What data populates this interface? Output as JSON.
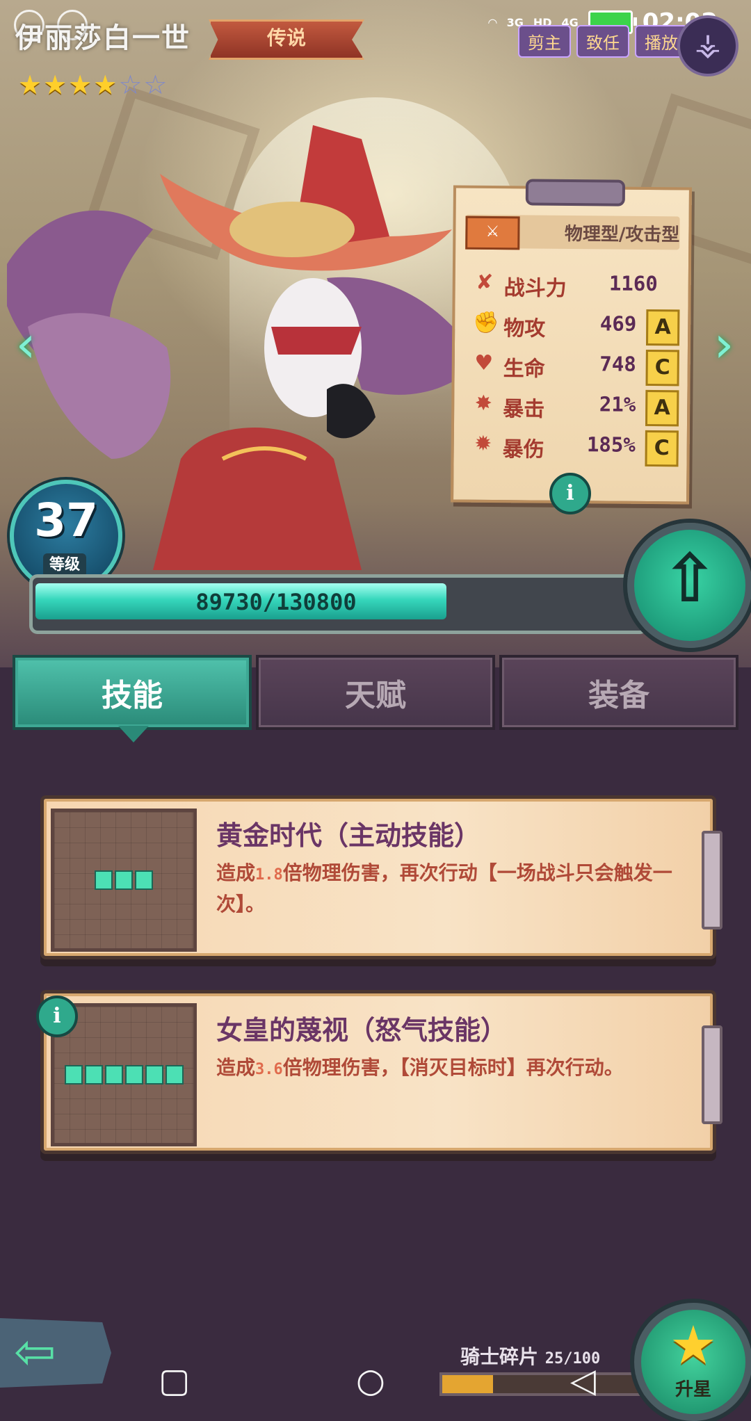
{
  "status_bar": {
    "signal_a": "3G",
    "signal_b": "4G",
    "hd": "HD",
    "time": "02:02"
  },
  "hero": {
    "name": "伊丽莎白一世",
    "rarity": "传说",
    "stars_total": 6,
    "stars_filled": 4,
    "top_buttons": [
      "剪主",
      "致任",
      "播放"
    ],
    "skin_icon": "fish-skeleton-icon"
  },
  "stat_card": {
    "type_label": "物理型/攻击型",
    "weapon_icon": "sword-icon",
    "stats": [
      {
        "icon": "power-icon",
        "glyph": "✘",
        "name": "战斗力",
        "value": "1160",
        "grade": ""
      },
      {
        "icon": "fist-icon",
        "glyph": "✊",
        "name": "物攻",
        "value": "469",
        "grade": "A"
      },
      {
        "icon": "heart-icon",
        "glyph": "♥",
        "name": "生命",
        "value": "748",
        "grade": "C"
      },
      {
        "icon": "crit-icon",
        "glyph": "✸",
        "name": "暴击",
        "value": "21%",
        "grade": "A"
      },
      {
        "icon": "crit-damage-icon",
        "glyph": "✹",
        "name": "暴伤",
        "value": "185%",
        "grade": "C"
      }
    ]
  },
  "level": {
    "value": "37",
    "label": "等级"
  },
  "exp": {
    "text": "89730/130800",
    "current": 89730,
    "max": 130800
  },
  "tabs": [
    {
      "label": "技能",
      "active": true
    },
    {
      "label": "天赋",
      "active": false
    },
    {
      "label": "装备",
      "active": false
    }
  ],
  "skills": [
    {
      "title": "黄金时代（主动技能）",
      "desc_pre": "造成",
      "desc_num": "1.8",
      "desc_post": "倍物理伤害，再次行动【一场战斗只会触发一次】。",
      "pips": 3
    },
    {
      "title": "女皇的蔑视（怒气技能）",
      "desc_pre": "造成",
      "desc_num": "3.6",
      "desc_post": "倍物理伤害，【消灭目标时】再次行动。",
      "pips": 6
    }
  ],
  "bottom": {
    "shards_label": "骑士碎片",
    "shards_count": "25/100",
    "shards_current": 25,
    "shards_max": 100,
    "star_up_label": "升星"
  },
  "colors": {
    "accent": "#36d7bc",
    "star_gold": "#ffcf2b",
    "skill_text": "#b04a38",
    "title": "#6a3566"
  }
}
